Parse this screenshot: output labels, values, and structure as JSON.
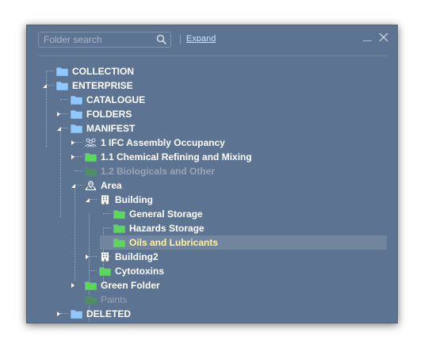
{
  "search": {
    "placeholder": "Folder search"
  },
  "header": {
    "expand_label": "Expand"
  },
  "colors": {
    "panel_bg": "#5d7392",
    "folder_blue": "#8ec8ff",
    "folder_green": "#5bd85b",
    "folder_green_dim": "#4e8e62",
    "selected_text": "#fff3a0"
  },
  "tree": [
    {
      "label": "COLLECTION",
      "icon": "folder-blue-icon",
      "toggle": "none",
      "style": "bold"
    },
    {
      "label": "ENTERPRISE",
      "icon": "folder-blue-icon",
      "toggle": "expanded",
      "style": "bold"
    },
    {
      "label": "CATALOGUE",
      "icon": "folder-blue-icon",
      "toggle": "none",
      "style": "bold"
    },
    {
      "label": "FOLDERS",
      "icon": "folder-blue-icon",
      "toggle": "collapsed",
      "style": "bold"
    },
    {
      "label": "MANIFEST",
      "icon": "folder-blue-icon",
      "toggle": "expanded",
      "style": "bold"
    },
    {
      "label": "1 IFC Assembly Occupancy",
      "icon": "people-icon",
      "toggle": "collapsed",
      "style": "bold"
    },
    {
      "label": "1.1 Chemical Refining and Mixing",
      "icon": "folder-green-icon",
      "toggle": "collapsed",
      "style": "bold"
    },
    {
      "label": "1.2 Biologicals and Other",
      "icon": "folder-green-dim-icon",
      "toggle": "none",
      "style": "dim-bold"
    },
    {
      "label": "Area",
      "icon": "map-pin-icon",
      "toggle": "expanded",
      "style": "bold"
    },
    {
      "label": "Building",
      "icon": "building-icon",
      "toggle": "expanded",
      "style": "bold"
    },
    {
      "label": "General Storage",
      "icon": "folder-green-icon",
      "toggle": "none",
      "style": "bold"
    },
    {
      "label": "Hazards Storage",
      "icon": "folder-green-icon",
      "toggle": "none",
      "style": "bold"
    },
    {
      "label": "Oils and Lubricants",
      "icon": "folder-green-icon",
      "toggle": "none",
      "style": "selected"
    },
    {
      "label": "Building2",
      "icon": "building-icon",
      "toggle": "collapsed",
      "style": "bold"
    },
    {
      "label": "Cytotoxins",
      "icon": "folder-green-icon",
      "toggle": "none",
      "style": "bold"
    },
    {
      "label": "Green Folder",
      "icon": "folder-green-icon",
      "toggle": "collapsed",
      "style": "bold"
    },
    {
      "label": "Paints",
      "icon": "folder-green-dim-icon",
      "toggle": "none",
      "style": "dim"
    },
    {
      "label": "DELETED",
      "icon": "folder-blue-icon",
      "toggle": "collapsed",
      "style": "bold"
    }
  ]
}
